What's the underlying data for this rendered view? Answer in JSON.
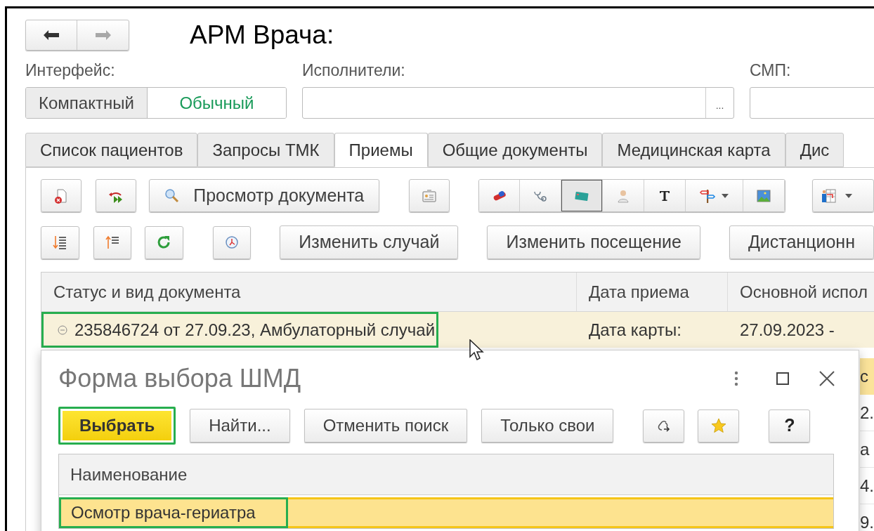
{
  "nav": {
    "title": "АРМ Врача:"
  },
  "interface": {
    "label": "Интерфейс:",
    "options": [
      {
        "label": "Компактный",
        "selected": false
      },
      {
        "label": "Обычный",
        "selected": true
      }
    ]
  },
  "performers": {
    "label": "Исполнители:",
    "button": "..."
  },
  "smp": {
    "label": "СМП:"
  },
  "tabs": [
    {
      "label": "Список пациентов",
      "selected": false
    },
    {
      "label": "Запросы ТМК",
      "selected": false
    },
    {
      "label": "Приемы",
      "selected": true
    },
    {
      "label": "Общие документы",
      "selected": false
    },
    {
      "label": "Медицинская карта",
      "selected": false
    },
    {
      "label": "Дис",
      "selected": false
    }
  ],
  "toolbar_1": {
    "document_button": "Просмотр документа",
    "group": [
      {
        "kind": "pill",
        "pressed": false
      },
      {
        "kind": "stethoscope",
        "pressed": false
      },
      {
        "kind": "card",
        "pressed": true
      },
      {
        "kind": "doctor",
        "pressed": false
      },
      {
        "kind": "text",
        "pressed": false
      },
      {
        "kind": "signpost",
        "pressed": false
      },
      {
        "kind": "picture",
        "pressed": false
      }
    ]
  },
  "toolbar_2": {
    "buttons": [
      "Изменить случай",
      "Изменить посещение",
      "Дистанционн"
    ]
  },
  "table": {
    "columns": [
      "Статус и вид документа",
      "Дата приема",
      "Основной испол"
    ],
    "rows": [
      {
        "expanded": true,
        "highlighted": true,
        "cells": [
          "235846724 от 27.09.23, Амбулаторный случай",
          "Дата карты:",
          "27.09.2023 -"
        ]
      }
    ]
  },
  "edge_fragments": [
    "с",
    "2.",
    "а",
    "4.",
    "9."
  ],
  "dialog": {
    "title": "Форма выбора ШМД",
    "buttons": [
      {
        "label": "Выбрать",
        "default": true,
        "highlighted": true
      },
      {
        "label": "Найти...",
        "default": false,
        "highlighted": false
      },
      {
        "label": "Отменить поиск",
        "default": false,
        "highlighted": false
      },
      {
        "label": "Только свои",
        "default": false,
        "highlighted": false
      }
    ],
    "help": "?",
    "table": {
      "columns": [
        "Наименование"
      ],
      "rows": [
        {
          "selected": true,
          "highlighted": true,
          "cells": [
            "Осмотр врача-гериатра"
          ]
        }
      ]
    }
  }
}
